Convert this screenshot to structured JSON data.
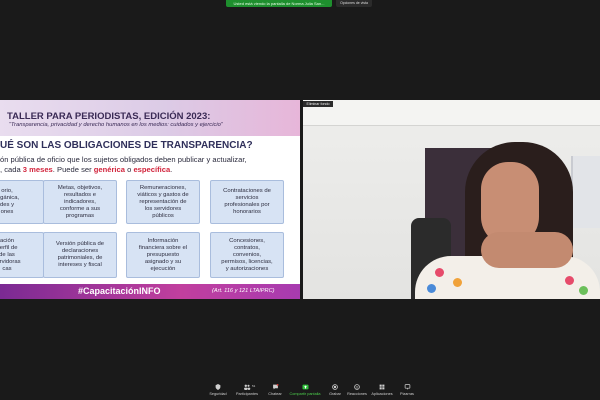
{
  "share_banner": {
    "text": "Usted está viendo la pantalla de Norma Julia San...",
    "view_options": "Opciones de vista"
  },
  "slide": {
    "title": "TALLER PARA PERIODISTAS, EDICIÓN 2023:",
    "subtitle": "“Transparencia, privacidad y derecho humanos en los medios: cuidados y ejercicio”",
    "question": "UÉ SON LAS OBLIGACIONES DE TRANSPARENCIA?",
    "intro_line1": "ón pública de oficio que los sujetos obligados deben publicar y actualizar,",
    "intro_line2_prefix": ", cada ",
    "intro_highlight1": "3 meses",
    "intro_mid": ". Puede ser ",
    "intro_highlight2": "genérica",
    "intro_or": " o ",
    "intro_highlight3": "específica",
    "intro_end": ".",
    "cards": [
      "orio,\norgánica,\ndes y\nones",
      "Metas, objetivos,\nresultados e\nindicadores,\nconforme a sus\nprogramas",
      "Remuneraciones,\nviáticos y gastos de\nrepresentación de\nlos servidores\npúblicos",
      "Contrataciones de\nservicios\nprofesionales por\nhonorarios",
      "ación\nperfil de\nde las\nservidoras\ncas",
      "Versión pública de\ndeclaraciones\npatrimoniales, de\nintereses y fiscal",
      "Información\nfinanciera sobre el\npresupuesto\nasignado y su\nejecución",
      "Concesiones,\ncontratos,\nconvenios,\npermisos, licencias,\ny autorizaciones"
    ],
    "hashtag": "#CapacitaciónINFO",
    "law_ref": "(Art. 116 y 121 LTAIPRC)"
  },
  "video_tile": {
    "remove_background": "Eliminar fondo"
  },
  "toolbar": {
    "buttons": [
      {
        "name": "security",
        "label": "Seguridad",
        "icon": "shield-icon"
      },
      {
        "name": "participants",
        "label": "Participantes",
        "icon": "participants-icon",
        "count": "51"
      },
      {
        "name": "chat",
        "label": "Chatear",
        "icon": "chat-icon"
      },
      {
        "name": "share-screen",
        "label": "Compartir pantalla",
        "icon": "share-screen-icon"
      },
      {
        "name": "record",
        "label": "Grabar",
        "icon": "record-icon"
      },
      {
        "name": "reactions",
        "label": "Reacciones",
        "icon": "reaction-icon"
      },
      {
        "name": "apps",
        "label": "Aplicaciones",
        "icon": "apps-icon"
      },
      {
        "name": "whiteboards",
        "label": "Pizarras",
        "icon": "whiteboard-icon"
      }
    ]
  },
  "colors": {
    "share_green": "#1e8f2e",
    "slide_red": "#d2243c",
    "footer_purple": "#7b2a93",
    "card_blue": "#d7e3f4"
  }
}
